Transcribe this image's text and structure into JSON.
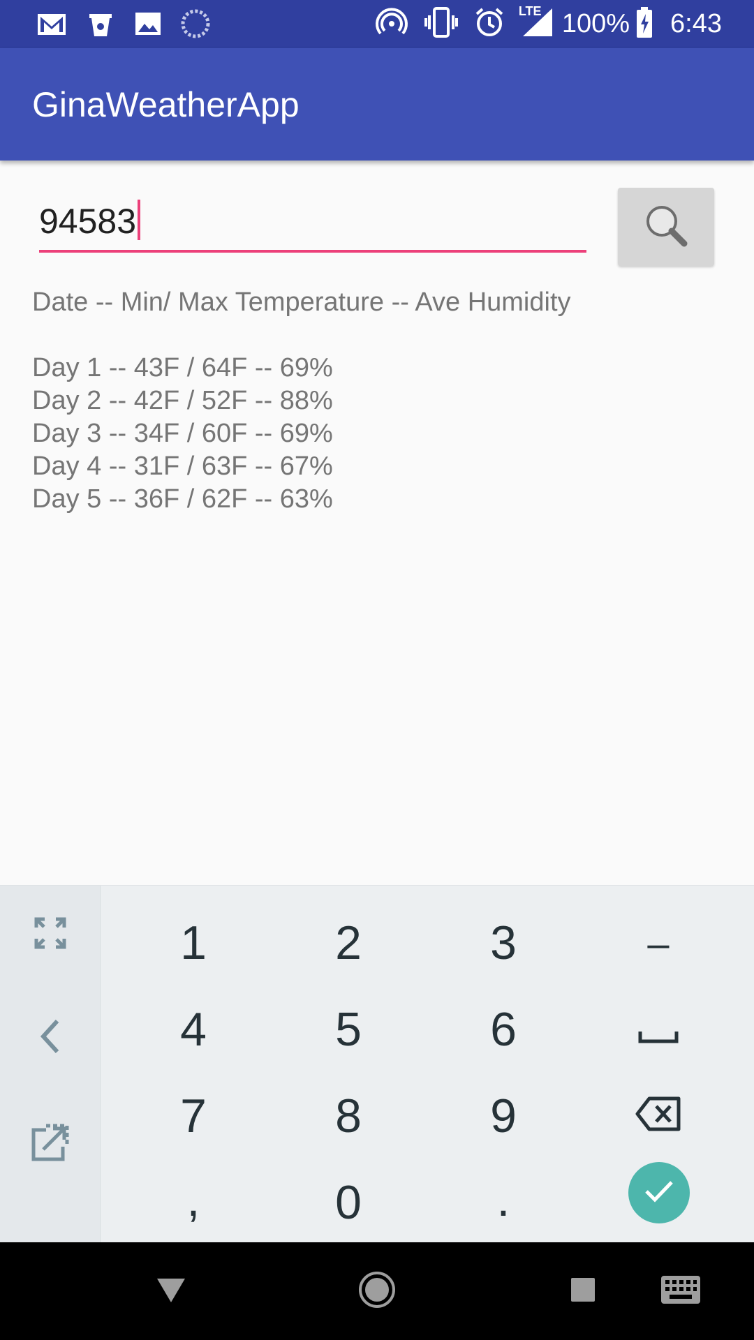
{
  "status_bar": {
    "battery_percent": "100%",
    "time": "6:43",
    "network": "LTE",
    "left_icons": [
      "gmail-icon",
      "bucket-icon",
      "image-icon",
      "sync-icon"
    ],
    "right_icons": [
      "hotspot-icon",
      "vibrate-icon",
      "alarm-icon",
      "lte-signal-icon",
      "battery-icon"
    ]
  },
  "app_bar": {
    "title": "GinaWeatherApp"
  },
  "search": {
    "zip_value": "94583",
    "button_icon": "search-icon"
  },
  "forecast": {
    "header": "Date -- Min/ Max Temperature -- Ave Humidity",
    "rows": [
      "Day 1 -- 43F / 64F -- 69%",
      "Day 2 -- 42F / 52F -- 88%",
      "Day 3 -- 34F / 60F -- 69%",
      "Day 4 -- 31F / 63F -- 67%",
      "Day 5 -- 36F / 62F -- 63%"
    ]
  },
  "keyboard": {
    "keys": [
      "1",
      "2",
      "3",
      "–",
      "4",
      "5",
      "6",
      "␣",
      "7",
      "8",
      "9",
      "backspace",
      ",",
      "0",
      ".",
      "done"
    ],
    "side_buttons": [
      "expand-icon",
      "back-arrow-icon",
      "open-external-icon"
    ]
  },
  "nav_bar": {
    "buttons": [
      "back-icon",
      "home-icon",
      "recents-icon",
      "keyboard-icon"
    ]
  },
  "colors": {
    "primary": "#3f51b5",
    "primary_dark": "#303f9f",
    "accent": "#ec407a",
    "done_button": "#4db6ac"
  }
}
